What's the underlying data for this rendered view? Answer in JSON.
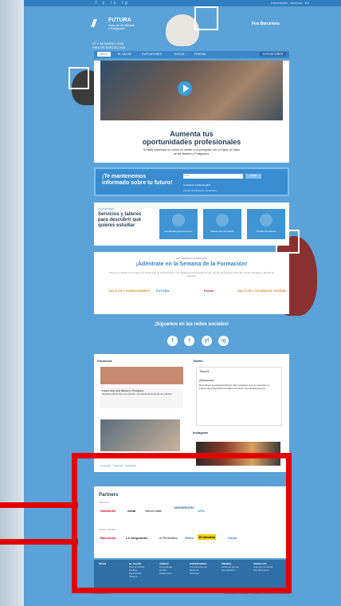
{
  "topbar": {
    "social": "f y in ig",
    "links": "Información · Accesos · En"
  },
  "header": {
    "logo_name": "FUTURA",
    "logo_sub": "Salón de los Másters\ny Postgrados",
    "date": "27 Y 28 MARZO 2020\nFIRA DE BARCELONA",
    "brand_right": "Fira Barcelona"
  },
  "nav": {
    "items": [
      "INICIO",
      "EL SALÓN",
      "EXPOSITORES",
      "VISITAR",
      "PRENSA"
    ],
    "cta": "EXPOSITORES"
  },
  "hero": {
    "title_line1": "Aumenta tus",
    "title_line2": "oportunidades profesionales",
    "text": "Si estás interesado en cursar un máster o un postgrado ven a Futura, el Salón de los Másters y Postgrados."
  },
  "newsletter": {
    "question": "¡Te mantenemos informado sobre tu futuro!",
    "input_placeholder": "Email",
    "button": "Enviar",
    "options": "Castellano   Català   English",
    "legal": "Acepto la política de privacidad"
  },
  "services": {
    "kicker": "ACTIVIDADES",
    "heading": "Servicios y talleres para descubrir qué quieres estudiar",
    "tiles": [
      "Actividades para descubrir",
      "Talleres de orientación",
      "Charlas formativas"
    ]
  },
  "week": {
    "kicker": "EN · SEMANA FORMACIÓN",
    "heading": "¡Adéntrate en la Semana de la Formación!",
    "desc": "Futura se celebra en el marco de la Semana de la Formación y del Trabajo de Fira de Barcelona, una de las grandes citas del mundo educativo y laboral de España.",
    "logos": [
      "SALÓ DE L'ENSENYAMENT",
      "FUTURA",
      "Fórum",
      "SALÓ DE L'OCUPACIÓ JUVENIL"
    ]
  },
  "social": {
    "heading": "¡Síguenos en las redes sociales!",
    "icons": [
      "f",
      "t",
      "yt",
      "ig"
    ]
  },
  "feeds": {
    "facebook_label": "Facebook",
    "fb_page": "Futura Salo dels Masters i Postgraus",
    "fb_post": "Aprofita l'oferta que ens ofereix el professorat d'escola de màsters",
    "fb_foot": "Compartir  ·  Comentar  ·  M'agrada",
    "twitter_label": "Twitter",
    "tw_head": "Tweets",
    "tw_account": "@firamasters",
    "tw_text": "Descobreix la varietat d'ofertes dels postgraus que es presenten a Futura. Els programes formatius ofereixen una àmplia gamma.",
    "instagram_label": "Instagram"
  },
  "partners": {
    "heading": "Partners",
    "group1": "Patrocina",
    "group1_logos": [
      "Santander",
      "canal",
      "Universitat",
      "UNIVERSITAT",
      "UVic"
    ],
    "group2": "Medios oficiales",
    "group2_logos": [
      "Barcelona",
      "La Vanguardia",
      "el Periódico",
      "Ràdio",
      "20 minutos",
      "Sónar"
    ]
  },
  "footer": {
    "cols": [
      {
        "title": "INICIO",
        "lines": ""
      },
      {
        "title": "EL SALÓN",
        "lines": "Qué es Futura\nPerfiles\nExpositores\nTalleres"
      },
      {
        "title": "VISITAR",
        "lines": "Cómo llegar\nHorario\nAlojamiento"
      },
      {
        "title": "EXPOSITORES",
        "lines": "Por qué exponer\nReserva\nServicios"
      },
      {
        "title": "PRENSA",
        "lines": "Notas de prensa\nAcreditación"
      },
      {
        "title": "CONTACTO",
        "lines": "Atención al cliente\nFira Barcelona"
      }
    ],
    "bottom_left": "Fira Barcelona",
    "bottom_right": "Aviso legal · Privacidad · Cookies · © 2020 Fira de Barcelona"
  }
}
